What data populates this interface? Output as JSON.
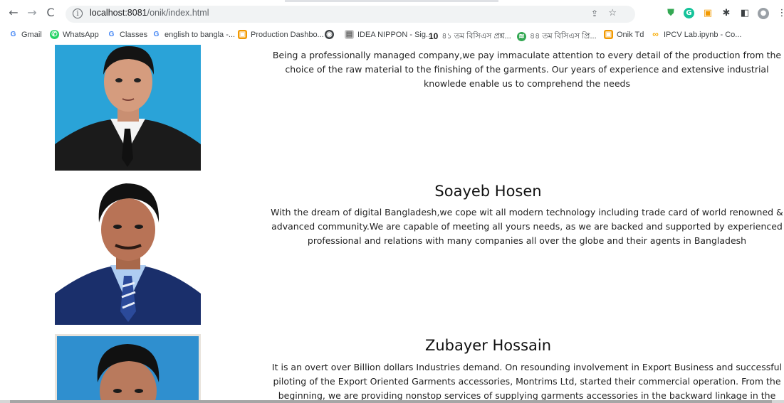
{
  "browser": {
    "url_host": "localhost:8081",
    "url_path": "/onik/index.html"
  },
  "bookmarks": [
    {
      "label": "Gmail",
      "icon": "google-g-icon",
      "color": "#4285f4",
      "glyph": "G"
    },
    {
      "label": "WhatsApp",
      "icon": "whatsapp-icon",
      "color": "#25d366",
      "glyph": "●"
    },
    {
      "label": "Classes",
      "icon": "google-g-icon",
      "color": "#4285f4",
      "glyph": "G"
    },
    {
      "label": "english to bangla -...",
      "icon": "google-g-icon",
      "color": "#4285f4",
      "glyph": "G"
    },
    {
      "label": "Production Dashbo...",
      "icon": "dashboard-icon",
      "color": "#f29900",
      "glyph": "▣"
    },
    {
      "label": "",
      "icon": "globe-icon",
      "color": "#3c4043",
      "glyph": "◉"
    },
    {
      "label": "IDEA NIPPON - Sig...",
      "icon": "image-icon",
      "color": "#9aa0a6",
      "glyph": "▤"
    },
    {
      "label": "৪১ তম বিসিএস প্রশ্ন...",
      "icon": "ten-minute-icon",
      "color": "#1a1a1a",
      "glyph": "10"
    },
    {
      "label": "৪৪ তম বিসিএস প্রি...",
      "icon": "leaf-icon",
      "color": "#34a853",
      "glyph": "≋"
    },
    {
      "label": "Onik Td",
      "icon": "dashboard-icon",
      "color": "#f29900",
      "glyph": "▣"
    },
    {
      "label": "IPCV Lab.ipynb - Co...",
      "icon": "colab-icon",
      "color": "#f9ab00",
      "glyph": "∞"
    }
  ],
  "members": [
    {
      "name": "",
      "bio": "Being a professionally managed company,we pay immaculate attention to every detail of the production from the choice of the raw material to the finishing of the garments. Our years of experience and extensive industrial knowlede enable us to comprehend the needs"
    },
    {
      "name": "Soayeb Hosen",
      "bio": "With the dream of digital Bangladesh,we cope wit all modern technology including trade card of world renowned & advanced community.We are capable of meeting all yours needs, as we are backed and supported by experienced professional and relations with many companies all over the globe and their agents in Bangladesh"
    },
    {
      "name": "Zubayer Hossain",
      "bio": "It is an overt over Billion dollars Industries demand. On resounding involvement in Export Business and successful piloting of the Export Oriented Garments accessories, Montrims Ltd, started their commercial operation. From the beginning, we are providing nonstop services of supplying garments accessories in the backward linkage in the garments sector."
    }
  ],
  "colors": {
    "photo_bg_1": "#2aa3d8",
    "photo_bg_2": "#ffffff",
    "photo_bg_3": "#2f8fcf",
    "suit_dark": "#1b1b1b",
    "suit_navy": "#1a2f6b"
  }
}
